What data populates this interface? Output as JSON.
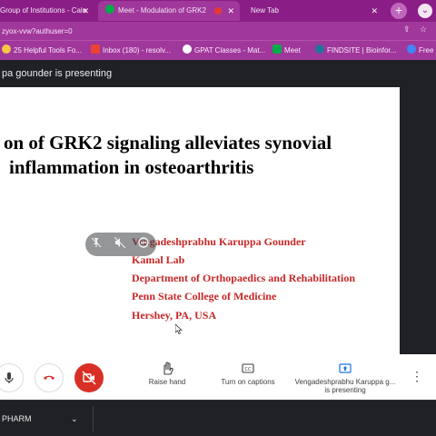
{
  "browser": {
    "tabs": [
      {
        "title": "Group of Institutions - Cale",
        "active": false
      },
      {
        "title": "Meet - Modulation of GRK2",
        "active": true,
        "recording": true
      },
      {
        "title": "New Tab",
        "active": false
      }
    ],
    "new_tab_symbol": "+",
    "tab_menu_symbol": "⌄",
    "url": "zyox-vvw?authuser=0",
    "bookmarks": [
      {
        "label": "25 Helpful Tools Fo...",
        "icon": "globe-icon",
        "color": "#f6c744"
      },
      {
        "label": "Inbox (180) - resolv...",
        "icon": "gmail-icon",
        "color": "#ea4335"
      },
      {
        "label": "GPAT Classes - Mat...",
        "icon": "globe-icon",
        "color": "#ffffff"
      },
      {
        "label": "Meet",
        "icon": "meet-icon",
        "color": "#00ac47"
      },
      {
        "label": "FINDSITE | Bioinfor...",
        "icon": "wordpress-icon",
        "color": "#21759b"
      },
      {
        "label": "Free",
        "icon": "globe-icon",
        "color": "#4285f4"
      }
    ]
  },
  "meet": {
    "presenter_banner": "pa gounder is presenting",
    "slide": {
      "title_line1": "on of GRK2 signaling alleviates synovial",
      "title_line2": "inflammation in osteoarthritis",
      "authors": [
        "Vengadeshprabhu Karuppa Gounder",
        "Kamal Lab",
        "Department of Orthopaedics and Rehabilitation",
        "Penn State College of Medicine",
        "Hershey, PA, USA"
      ],
      "author_color": "#c62828"
    },
    "controls": {
      "raise_hand": "Raise hand",
      "captions": "Turn on captions",
      "presenting_line1": "Vengadeshprabhu Karuppa g...",
      "presenting_line2": "is presenting",
      "more_symbol": "⋮"
    }
  },
  "taskbar": {
    "label": "PHARM",
    "chevron": "⌄"
  },
  "colors": {
    "chrome_tab_bar": "#8b1e86",
    "chrome_toolbar": "#a0379b",
    "meet_dark": "#202124",
    "hangup_red": "#d93025"
  }
}
